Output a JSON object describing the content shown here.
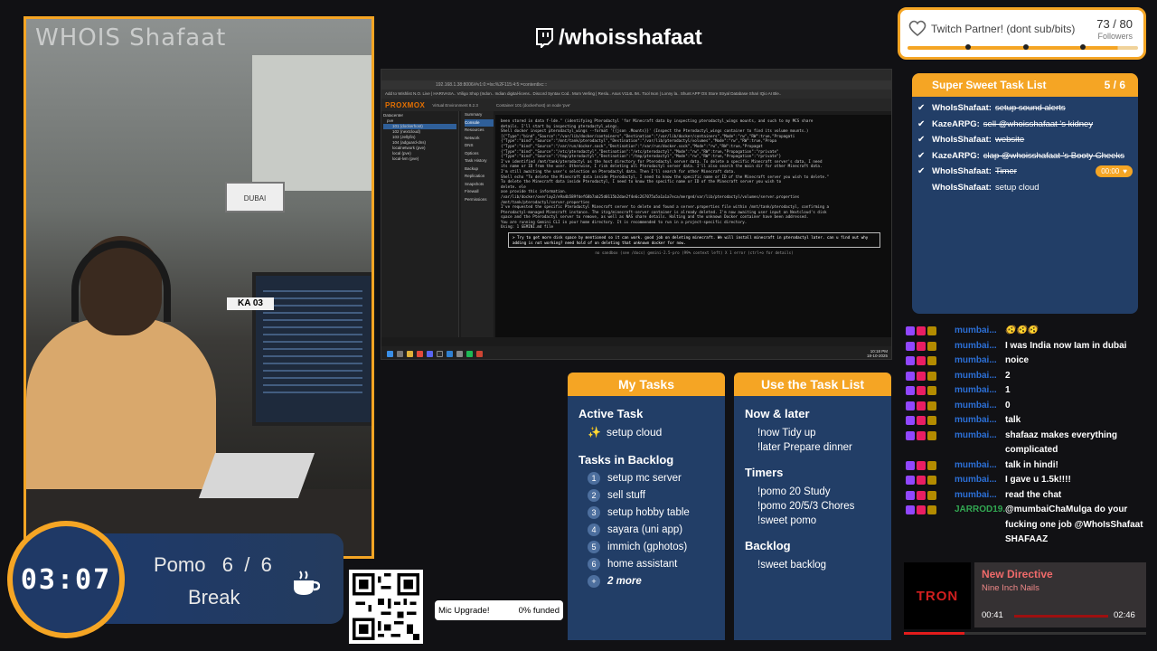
{
  "webcam": {
    "title": "WHOIS Shafaat",
    "plate": "KA 03",
    "sign": "DUBAI"
  },
  "pomo": {
    "time": "03:07",
    "label": "Pomo   6  /  6",
    "state": "Break",
    "icon": "coffee-icon"
  },
  "mic": {
    "label": "Mic Upgrade!",
    "funded": "0% funded"
  },
  "handle": {
    "text": "/whoisshafaat",
    "icon": "twitch-icon"
  },
  "screen": {
    "address": "192.168.1.38:8006/#v1:0:=lxc%2F115:4:5:=contentlxc:::",
    "bookmarks": "Add to Wishlist   N.O.   Live | HARIVASA..   Vriligo Shop (Indon..   Indian digital-licens..   Discord Syntax Cod..   Mom Verling | Reslu..   Asus V114L IM..   Tool Ison | Lonny la..   Shunt APP   OS Store   Stryal Database   Shari IQio   AI Ble..",
    "proxmox_logo": "PROXMOX",
    "proxmox_version": "Virtual Environment 8.2.3",
    "container": "Container 101 (dockerhost) on node 'pve'",
    "tree": [
      "Datacenter",
      "pve",
      "101 (dockerhost)",
      "102 (nextcloud)",
      "103 (Jellyfin)",
      "104 (adguard-dns)",
      "localnetwork (pve)",
      "local (pve)",
      "local-lvm (pve)"
    ],
    "menu": [
      "Summary",
      "Console",
      "Resources",
      "Network",
      "DNS",
      "Options",
      "Task History",
      "Backup",
      "Replication",
      "Snapshots",
      "Firewall",
      "Permissions"
    ],
    "console_lines": [
      "been stored in data f-lde.\" (identifying Pterodactyl 'for Minecraft data by inspecting pterodactyl_wings mounts, and such to my MCS share",
      "details. I'll start by inspecting pterodactyl_wings.",
      "Shell   docker inspect pterodactyl_wings --format '{{json .Mounts}}'  (Inspect the Pterodactyl_wings container to find its volume mounts.)",
      "[{\"Type\":\"bind\",\"Source\":\"/var/lib/docker/containers\",\"Destination\":\"/var/lib/docker/containers\",\"Mode\":\"rw\",\"RW\":true,\"Propagati",
      "{\"Type\":\"bind\",\"Source\":\"/mnt/tank/pterodactyl\",\"Destination\":\"/var/lib/pterodactyl/volumes\",\"Mode\":\"rw\",\"RW\":true,\"Propa",
      "{\"Type\":\"bind\",\"Source\":\"/var/run/docker.sock\",\"Destination\":\"/var/run/docker.sock\",\"Mode\":\"rw\",\"RW\":true,\"Propagat",
      "{\"Type\":\"bind\",\"Source\":\"/etc/pterodactyl\",\"Destination\":\"/etc/pterodactyl\",\"Mode\":\"rw\",\"RW\":true,\"Propagation\":\"rprivate\"",
      "{\"Type\":\"bind\",\"Source\":\"/tmp/pterodactyl\",\"Destination\":\"/tmp/pterodactyl\",\"Mode\":\"rw\",\"RW\":true,\"Propagation\":\"rprivate\"}",
      "I've identified /mnt/tank/pterodactyl as the host directory for Pterodactyl server data. To delete a specific Minecraft server's data, I need",
      "its name or ID from the user. Otherwise, I risk deleting all Pterodactyl server data. I'll also search the main dir for other Minecraft data.",
      "I'm still awaiting the user's selection on Pterodactyl data. Then I'll search for other Minecraft data.",
      "Shell   echo \"To delete the Minecraft data inside Pterodactyl, I need to know the specific name or ID of the Minecraft server you wish to delete.\"",
      "To delete the Minecraft data inside Pterodactyl, I need to know the specific name or ID of the Minecraft server you wish to",
      "delete. ele",
      "ase provide this information.",
      "/var/lib/docker/overlay2/e9a4b589fdef68b7ab25d0115b2dae2f4e6c267075a5a1a1a7eca/merged/var/lib/pterodactyl/volumes/server.properties",
      "/mnt/tank/pterodactyl/server.properties",
      "I've requested the specific Pterodactyl Minecraft server to delete and found a server.properties file within /mnt/tank/pterodactyl, confirming a",
      "Pterodactyl-managed Minecraft instance. The itzg/minecraft-server container is already deleted. I'm now awaiting user input on Nextcloud's disk",
      "space and the Pterodactyl server to remove, as well as NAS share details. Halting and the unknown Docker container have been addressed.",
      "You are running Gemini CLI in your home directory. It is recommended to run in a project-specific directory.",
      "Using: 1 GEMINI.md file"
    ],
    "console_input": "> Try to get more disk space by mentioned so it can work. good job on deleting minecraft. We will install minecraft in pterodactyl later. can u find out why adding is not working? need hold of on deleting that unknown docker for now.",
    "console_status": "no sandbox (see /docs)        gemini-2.5-pro (99% context left)        X 1 error (ctrl+o for details)",
    "clock_time": "10:18 PM",
    "clock_date": "18-10-2025"
  },
  "my_tasks": {
    "title": "My Tasks",
    "active_title": "Active Task",
    "active_icon": "sparkles-icon",
    "active_task": "setup cloud",
    "backlog_title": "Tasks in Backlog",
    "backlog": [
      {
        "n": "1",
        "text": "setup mc server"
      },
      {
        "n": "2",
        "text": "sell stuff"
      },
      {
        "n": "3",
        "text": "setup hobby table"
      },
      {
        "n": "4",
        "text": "sayara (uni app)"
      },
      {
        "n": "5",
        "text": "immich (gphotos)"
      },
      {
        "n": "6",
        "text": "home assistant"
      },
      {
        "n": "+",
        "text": "2 more"
      }
    ]
  },
  "use_tasks": {
    "title": "Use the Task List",
    "sections": [
      {
        "title": "Now & later",
        "cmds": [
          "!now Tidy up",
          "!later Prepare dinner"
        ]
      },
      {
        "title": "Timers",
        "cmds": [
          "!pomo 20 Study",
          "!pomo 20/5/3 Chores",
          "!sweet pomo"
        ]
      },
      {
        "title": "Backlog",
        "cmds": [
          "!sweet backlog"
        ]
      }
    ]
  },
  "goal": {
    "title": "Twitch Partner! (dont sub/bits)",
    "count": "73 / 80",
    "sub": "Followers",
    "progress": 0.9125,
    "icon": "heart-hand-icon"
  },
  "sst": {
    "title": "Super Sweet Task List",
    "count": "5 / 6",
    "items": [
      {
        "user": "WhoIsShafaat:",
        "task": "setup sound alerts",
        "done": true
      },
      {
        "user": "KazeARPG:",
        "task": "sell @whoisshafaat 's kidney",
        "done": true
      },
      {
        "user": "WhoIsShafaat:",
        "task": "website",
        "done": true
      },
      {
        "user": "KazeARPG:",
        "task": "clap @whoisshafaat 's Booty Cheeks",
        "done": true
      },
      {
        "user": "WhoIsShafaat:",
        "task": "Timer",
        "done": true,
        "timer": "00:00"
      },
      {
        "user": "WhoIsShafaat:",
        "task": "setup cloud",
        "done": false
      }
    ]
  },
  "chat": [
    {
      "user": "mumbai...",
      "text": "🫨🫨🫨",
      "green": false
    },
    {
      "user": "mumbai...",
      "text": "I was India now Iam in dubai",
      "green": false
    },
    {
      "user": "mumbai...",
      "text": "noice",
      "green": false
    },
    {
      "user": "mumbai...",
      "text": "2",
      "green": false
    },
    {
      "user": "mumbai...",
      "text": "1",
      "green": false
    },
    {
      "user": "mumbai...",
      "text": "0",
      "green": false
    },
    {
      "user": "mumbai...",
      "text": "talk",
      "green": false
    },
    {
      "user": "mumbai...",
      "text": "shafaaz makes everything complicated",
      "green": false
    },
    {
      "user": "mumbai...",
      "text": "talk in hindi!",
      "green": false
    },
    {
      "user": "mumbai...",
      "text": "I gave u 1.5k!!!!",
      "green": false
    },
    {
      "user": "mumbai...",
      "text": "read the chat",
      "green": false
    },
    {
      "user": "JARROD19...",
      "text": "@mumbaiChaMulga do your fucking one job @WhoIsShafaat SHAFAAZ",
      "green": true
    }
  ],
  "now_playing": {
    "art": "TRON",
    "title": "New Directive",
    "artist": "Nine Inch Nails",
    "current": "00:41",
    "duration": "02:46",
    "progress": 0.25
  },
  "colors": {
    "accent": "#f5a524",
    "panel": "#223e67",
    "chat_user": "#2c6fd6"
  }
}
